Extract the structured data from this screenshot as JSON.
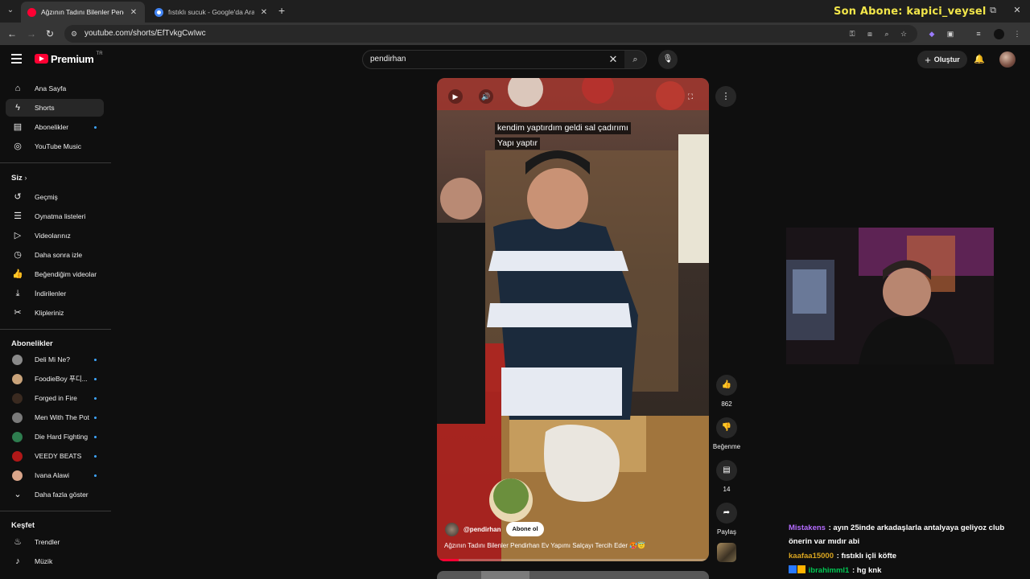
{
  "browser": {
    "tabs": [
      {
        "title": "Ağzının Tadını Bilenler Pendirhan",
        "active": true,
        "favicon_color": "#ff0033"
      },
      {
        "title": "fıstıklı sucuk - Google'da Ara",
        "active": false,
        "favicon_color": "#4285f4"
      }
    ],
    "url": "youtube.com/shorts/EfTvkgCwIwc",
    "overlay_title": "Son Abone: kapici_veysel"
  },
  "header": {
    "brand": "Premium",
    "region": "TR",
    "search_query": "pendirhan",
    "create_label": "Oluştur"
  },
  "sidebar": {
    "main_items": [
      {
        "label": "Ana Sayfa",
        "icon": "home-icon",
        "active": false
      },
      {
        "label": "Shorts",
        "icon": "shorts-icon",
        "active": true
      },
      {
        "label": "Abonelikler",
        "icon": "subscriptions-icon",
        "active": false,
        "dot": true
      },
      {
        "label": "YouTube Music",
        "icon": "music-icon",
        "active": false
      }
    ],
    "you_header": "Siz",
    "you_items": [
      {
        "label": "Geçmiş",
        "icon": "history-icon"
      },
      {
        "label": "Oynatma listeleri",
        "icon": "playlists-icon"
      },
      {
        "label": "Videolarınız",
        "icon": "your-videos-icon"
      },
      {
        "label": "Daha sonra izle",
        "icon": "watch-later-icon"
      },
      {
        "label": "Beğendiğim videolar",
        "icon": "liked-videos-icon"
      },
      {
        "label": "İndirilenler",
        "icon": "downloads-icon"
      },
      {
        "label": "Klipleriniz",
        "icon": "clips-icon"
      }
    ],
    "subs_header": "Abonelikler",
    "subscriptions": [
      {
        "label": "Deli Mi Ne?",
        "color": "#8a8a8a"
      },
      {
        "label": "FoodieBoy 푸디...",
        "color": "#c9a37a"
      },
      {
        "label": "Forged in Fire",
        "color": "#3a2a20"
      },
      {
        "label": "Men With The Pot",
        "color": "#7a7a7a"
      },
      {
        "label": "Die Hard Fighting",
        "color": "#2e7d4f"
      },
      {
        "label": "VEEDY BEATS",
        "color": "#b01818"
      },
      {
        "label": "Ivana Alawi",
        "color": "#d9a58a"
      }
    ],
    "show_more": "Daha fazla göster",
    "explore_header": "Keşfet",
    "explore_items": [
      {
        "label": "Trendler",
        "icon": "trending-icon"
      },
      {
        "label": "Müzik",
        "icon": "music-note-icon"
      }
    ]
  },
  "player": {
    "caption_lines": [
      "kendim yaptırdım geldi sal çadırımı",
      "Yapı yaptır"
    ],
    "channel": "@pendirhan",
    "subscribe_label": "Abone ol",
    "description": "Ağzının Tadını Bilenler Pendirhan Ev Yapımı Salçayı Tercih Eder 🥵😇",
    "progress": 0.08
  },
  "actions": {
    "likes": "862",
    "dislike_label": "Beğenme",
    "comments": "14",
    "share_label": "Paylaş"
  },
  "chat": [
    {
      "user": "Mistakens",
      "user_color": "#b56cff",
      "message": "ayın 25inde arkadaşlarla antalyaya geliyoz club önerin var mıdır abi",
      "badges": 0
    },
    {
      "user": "kaafaa15000",
      "user_color": "#daa520",
      "message": "fıstıklı içli köfte",
      "badges": 0
    },
    {
      "user": "ibrahimml1",
      "user_color": "#00c853",
      "message": "hg knk",
      "badges": 2
    }
  ]
}
